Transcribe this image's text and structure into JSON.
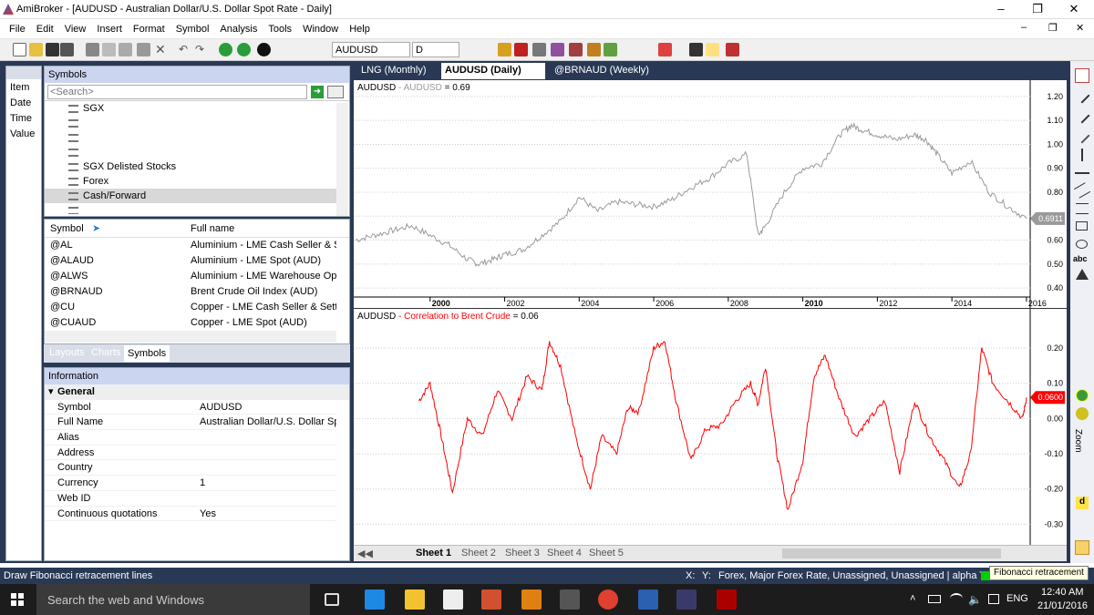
{
  "window": {
    "title": "AmiBroker - [AUDUSD - Australian Dollar/U.S. Dollar Spot Rate - Daily]"
  },
  "menu": [
    "File",
    "Edit",
    "View",
    "Insert",
    "Format",
    "Symbol",
    "Analysis",
    "Tools",
    "Window",
    "Help"
  ],
  "toolbar": {
    "symbol_value": "AUDUSD",
    "interval_value": "D"
  },
  "left_strip": {
    "items": [
      "Item",
      "Date",
      "Time",
      "Value"
    ]
  },
  "symbols_panel": {
    "title": "Symbols",
    "search_placeholder": "<Search>",
    "tree": [
      "SGX",
      "",
      "",
      "",
      "SGX Delisted Stocks",
      "Forex",
      "Cash/Forward",
      ""
    ],
    "selected_tree_index": 6,
    "columns": [
      "Symbol",
      "Full name"
    ],
    "rows": [
      [
        "@AL",
        "Aluminium - LME Cash Seller & Se"
      ],
      [
        "@ALAUD",
        "Aluminium - LME Spot (AUD)"
      ],
      [
        "@ALWS",
        "Aluminium - LME Warehouse Ope"
      ],
      [
        "@BRNAUD",
        "Brent Crude Oil Index (AUD)"
      ],
      [
        "@CU",
        "Copper - LME Cash Seller & Settler"
      ],
      [
        "@CUAUD",
        "Copper - LME Spot (AUD)"
      ]
    ],
    "tabs": [
      "Layouts",
      "Charts",
      "Symbols"
    ]
  },
  "info_panel": {
    "title": "Information",
    "group": "General",
    "rows": [
      [
        "Symbol",
        "AUDUSD"
      ],
      [
        "Full Name",
        "Australian Dollar/U.S. Dollar Spo"
      ],
      [
        "Alias",
        ""
      ],
      [
        "Address",
        ""
      ],
      [
        "Country",
        ""
      ],
      [
        "Currency",
        "1"
      ],
      [
        "Web ID",
        ""
      ],
      [
        "Continuous quotations",
        "Yes"
      ]
    ]
  },
  "chart_tabs": [
    "LNG (Monthly)",
    "AUDUSD (Daily)",
    "@BRNAUD (Weekly)"
  ],
  "sheets": [
    "Sheet 1",
    "Sheet 2",
    "Sheet 3",
    "Sheet 4",
    "Sheet 5"
  ],
  "status": {
    "left": "Draw Fibonacci retracement lines",
    "xy_x": "X:",
    "xy_y": "Y:",
    "right": "Forex, Major Forex Rate, Unassigned, Unassigned | alpha Test",
    "tooltip": "Fibonacci retracement"
  },
  "taskbar": {
    "search": "Search the web and Windows",
    "lang": "ENG",
    "time": "12:40 AM",
    "date": "21/01/2016"
  },
  "rtool_label": "Zoom",
  "colors": {
    "price": "#9a9a9a",
    "corr": "#ff0000",
    "panel_bg": "#293955",
    "header": "#ccd5f0"
  },
  "chart_data": [
    {
      "type": "line",
      "title": "AUDUSD - AUDUSD = 0.69",
      "title_symbol": "AUDUSD",
      "series_label": "AUDUSD",
      "series_value": "= 0.69",
      "x_ticks": [
        "2000",
        "2002",
        "2004",
        "2006",
        "2008",
        "2010",
        "2012",
        "2014",
        "2016"
      ],
      "y_ticks": [
        "1.20",
        "1.10",
        "1.00",
        "0.90",
        "0.80",
        "0.70",
        "0.60",
        "0.50",
        "0.40"
      ],
      "ylim": [
        0.37,
        1.23
      ],
      "last_value_label": "0.6911",
      "series": [
        {
          "name": "AUDUSD",
          "x": [
            1998.0,
            1998.5,
            1999.0,
            1999.5,
            2000.0,
            2000.5,
            2001.0,
            2001.3,
            2001.7,
            2002.0,
            2002.5,
            2003.0,
            2003.5,
            2004.0,
            2004.5,
            2005.0,
            2005.5,
            2006.0,
            2006.5,
            2007.0,
            2007.5,
            2008.0,
            2008.5,
            2008.8,
            2009.0,
            2009.5,
            2010.0,
            2010.5,
            2011.0,
            2011.3,
            2011.6,
            2012.0,
            2012.5,
            2013.0,
            2013.3,
            2013.6,
            2014.0,
            2014.5,
            2015.0,
            2015.5,
            2016.0
          ],
          "values": [
            0.6,
            0.62,
            0.64,
            0.66,
            0.62,
            0.58,
            0.52,
            0.5,
            0.52,
            0.54,
            0.56,
            0.62,
            0.68,
            0.78,
            0.72,
            0.76,
            0.75,
            0.74,
            0.77,
            0.82,
            0.86,
            0.92,
            0.96,
            0.62,
            0.66,
            0.8,
            0.9,
            0.92,
            1.04,
            1.08,
            1.06,
            1.04,
            1.02,
            1.04,
            1.02,
            0.96,
            0.88,
            0.93,
            0.8,
            0.74,
            0.69
          ]
        }
      ]
    },
    {
      "type": "line",
      "title": "AUDUSD - Correlation to Brent Crude = 0.06",
      "title_symbol": "AUDUSD",
      "series_label": "Correlation to Brent Crude",
      "series_value": "= 0.06",
      "y_ticks": [
        "0.20",
        "0.10",
        "0.00",
        "-0.10",
        "-0.20",
        "-0.30"
      ],
      "ylim": [
        -0.33,
        0.27
      ],
      "last_value_label": "0.0600",
      "series": [
        {
          "name": "Correlation to Brent Crude",
          "x": [
            1999.7,
            2000.0,
            2000.3,
            2000.6,
            2001.0,
            2001.4,
            2001.8,
            2002.2,
            2002.6,
            2003.0,
            2003.2,
            2003.5,
            2003.9,
            2004.3,
            2004.6,
            2005.0,
            2005.3,
            2005.6,
            2006.0,
            2006.3,
            2006.6,
            2007.0,
            2007.4,
            2007.8,
            2008.2,
            2008.6,
            2008.8,
            2009.0,
            2009.3,
            2009.6,
            2010.0,
            2010.3,
            2010.6,
            2011.0,
            2011.4,
            2011.8,
            2012.2,
            2012.6,
            2013.0,
            2013.4,
            2013.8,
            2014.2,
            2014.5,
            2014.8,
            2015.1,
            2015.5,
            2015.9,
            2016.0
          ],
          "values": [
            0.05,
            0.1,
            -0.05,
            -0.21,
            0.0,
            -0.05,
            0.08,
            0.0,
            0.12,
            0.08,
            0.22,
            0.15,
            -0.05,
            -0.2,
            -0.05,
            -0.1,
            0.03,
            0.02,
            0.2,
            0.22,
            0.05,
            -0.12,
            -0.03,
            -0.02,
            0.05,
            0.1,
            0.04,
            0.15,
            -0.1,
            -0.26,
            -0.12,
            0.12,
            0.18,
            0.05,
            -0.05,
            0.0,
            0.05,
            -0.15,
            0.05,
            -0.05,
            -0.12,
            -0.2,
            -0.1,
            0.2,
            0.1,
            0.05,
            0.0,
            0.06
          ]
        }
      ]
    }
  ]
}
